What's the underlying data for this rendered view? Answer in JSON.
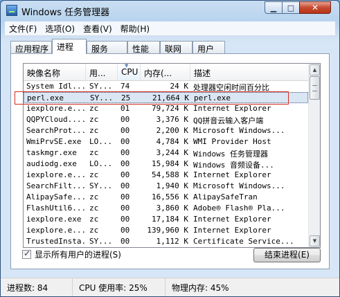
{
  "window": {
    "title": "Windows 任务管理器",
    "min": "▁",
    "max": "□",
    "close": "✕"
  },
  "menu": [
    "文件(F)",
    "选项(O)",
    "查看(V)",
    "帮助(H)"
  ],
  "tabs": [
    {
      "label": "应用程序",
      "active": false
    },
    {
      "label": "进程",
      "active": true
    },
    {
      "label": "服务",
      "active": false
    },
    {
      "label": "性能",
      "active": false
    },
    {
      "label": "联网",
      "active": false
    },
    {
      "label": "用户",
      "active": false
    }
  ],
  "columns": {
    "name": "映像名称",
    "user": "用...",
    "cpu": "CPU",
    "mem": "内存(...",
    "desc": "描述",
    "sorted": "cpu"
  },
  "rows": [
    {
      "name": "System Idl...",
      "user": "SY...",
      "cpu": "74",
      "mem": "24 K",
      "desc": "处理器空闲时间百分比"
    },
    {
      "name": "perl.exe",
      "user": "SY...",
      "cpu": "25",
      "mem": "21,664 K",
      "desc": "perl.exe",
      "selected": true
    },
    {
      "name": "iexplore.e...",
      "user": "zc",
      "cpu": "01",
      "mem": "79,724 K",
      "desc": "Internet Explorer"
    },
    {
      "name": "QQPYCloud....",
      "user": "zc",
      "cpu": "00",
      "mem": "3,376 K",
      "desc": "QQ拼音云输入客户端"
    },
    {
      "name": "SearchProt...",
      "user": "zc",
      "cpu": "00",
      "mem": "2,200 K",
      "desc": "Microsoft Windows..."
    },
    {
      "name": "WmiPrvSE.exe",
      "user": "LO...",
      "cpu": "00",
      "mem": "4,784 K",
      "desc": "WMI Provider Host"
    },
    {
      "name": "taskmgr.exe",
      "user": "zc",
      "cpu": "00",
      "mem": "3,244 K",
      "desc": "Windows 任务管理器"
    },
    {
      "name": "audiodg.exe",
      "user": "LO...",
      "cpu": "00",
      "mem": "15,984 K",
      "desc": "Windows 音频设备..."
    },
    {
      "name": "iexplore.e...",
      "user": "zc",
      "cpu": "00",
      "mem": "54,588 K",
      "desc": "Internet Explorer"
    },
    {
      "name": "SearchFilt...",
      "user": "SY...",
      "cpu": "00",
      "mem": "1,940 K",
      "desc": "Microsoft Windows..."
    },
    {
      "name": "AlipaySafe...",
      "user": "zc",
      "cpu": "00",
      "mem": "16,556 K",
      "desc": "AlipaySafeTran"
    },
    {
      "name": "FlashUtil6...",
      "user": "zc",
      "cpu": "00",
      "mem": "3,860 K",
      "desc": "Adobe® Flash® Pla..."
    },
    {
      "name": "iexplore.exe",
      "user": "zc",
      "cpu": "00",
      "mem": "17,184 K",
      "desc": "Internet Explorer"
    },
    {
      "name": "iexplore.e...",
      "user": "zc",
      "cpu": "00",
      "mem": "139,960 K",
      "desc": "Internet Explorer"
    },
    {
      "name": "TrustedInsta...",
      "user": "SY...",
      "cpu": "00",
      "mem": "1,112 K",
      "desc": "Certificate Service..."
    }
  ],
  "scroll": {
    "up": "▲",
    "down": "▼"
  },
  "show_all_users": {
    "label": "显示所有用户的进程(S)",
    "checked": true
  },
  "end_process_label": "结束进程(E)",
  "status": {
    "processes": "进程数: 84",
    "cpu": "CPU 使用率: 25%",
    "memory": "物理内存: 45%"
  }
}
